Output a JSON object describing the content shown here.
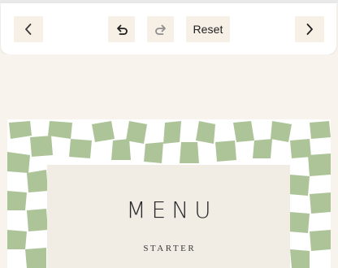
{
  "toolbar": {
    "prev_icon": "chevron-left-icon",
    "undo_icon": "undo-icon",
    "redo_icon": "redo-icon",
    "reset_label": "Reset",
    "next_icon": "chevron-right-icon"
  },
  "card": {
    "title": "MENU",
    "section": "STARTER",
    "pattern_color": "#a9c194",
    "panel_color": "#f1ece4"
  },
  "colors": {
    "background": "#f8f4ed",
    "button_bg": "#f6f0e6",
    "icon": "#2b2b2b",
    "icon_disabled": "#9a9a9a"
  }
}
